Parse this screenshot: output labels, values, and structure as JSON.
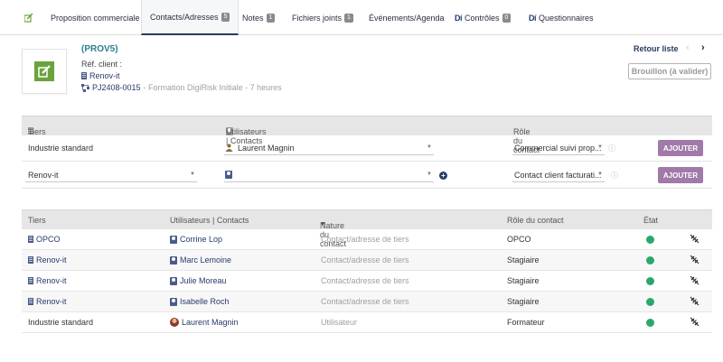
{
  "tabs": [
    {
      "label": "Proposition commerciale",
      "badge": ""
    },
    {
      "label": "Contacts/Adresses",
      "badge": "5"
    },
    {
      "label": "Notes",
      "badge": "1"
    },
    {
      "label": "Fichiers joints",
      "badge": "1"
    },
    {
      "label": "Événements/Agenda",
      "badge": ""
    },
    {
      "label": "Contrôles",
      "badge": "0",
      "prefix": "Dí"
    },
    {
      "label": "Questionnaires",
      "badge": "",
      "prefix": "Dí"
    }
  ],
  "header": {
    "ref_title": "(PROV5)",
    "ref_client_label": "Réf. client :",
    "company": "Renov-it",
    "project_code": "PJ2408-0015",
    "project_desc": " - Formation DigiRisk Initiale - 7 heures",
    "retour": "Retour liste",
    "prev_arrow": "‹",
    "next_arrow": "›",
    "status": "Brouillon (à valider)"
  },
  "add_table": {
    "headers": {
      "tiers": "Tiers",
      "users_contacts": "Utilisateurs | Contacts",
      "role": "Rôle du contact"
    },
    "row1": {
      "tiers": "Industrie standard",
      "user": "Laurent Magnin",
      "role": "Commercial suivi prop...",
      "button": "AJOUTER"
    },
    "row2": {
      "tiers": "Renov-it",
      "contact": "",
      "role": "Contact client facturati...",
      "button": "AJOUTER"
    }
  },
  "list_table": {
    "headers": {
      "tiers": "Tiers",
      "users_contacts": "Utilisateurs | Contacts",
      "nature": "Nature du contact",
      "role": "Rôle du contact",
      "etat": "État"
    },
    "rows": [
      {
        "tiers": "OPCO",
        "contact": "Corrine Lop",
        "nature": "Contact/adresse de tiers",
        "role": "OPCO"
      },
      {
        "tiers": "Renov-it",
        "contact": "Marc Lemoine",
        "nature": "Contact/adresse de tiers",
        "role": "Stagiaire"
      },
      {
        "tiers": "Renov-it",
        "contact": "Julie Moreau",
        "nature": "Contact/adresse de tiers",
        "role": "Stagiaire"
      },
      {
        "tiers": "Renov-it",
        "contact": "Isabelle Roch",
        "nature": "Contact/adresse de tiers",
        "role": "Stagiaire"
      },
      {
        "tiers": "Industrie standard",
        "contact": "Laurent Magnin",
        "nature": "Utilisateur",
        "role": "Formateur"
      }
    ]
  },
  "colors": {
    "accent": "#263c5c",
    "teal": "#2d7f8e",
    "button": "#a07aa8",
    "status_ok": "#2aa86a"
  }
}
